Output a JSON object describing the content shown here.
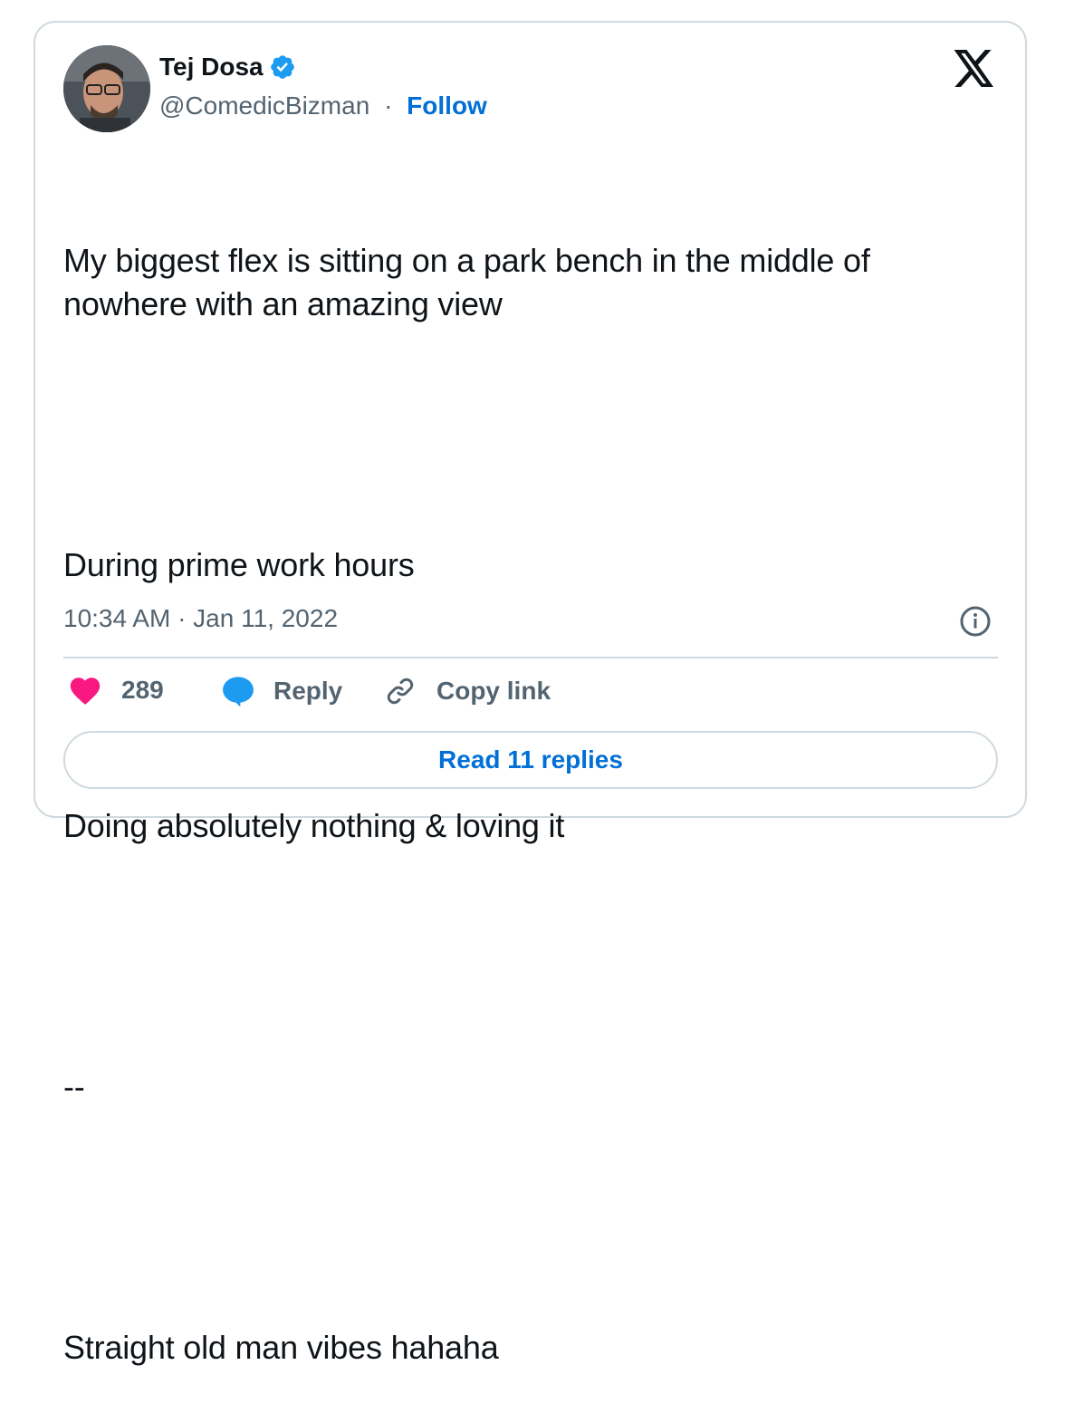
{
  "author": {
    "name": "Tej Dosa",
    "handle": "@ComedicBizman",
    "separator": "·",
    "follow_label": "Follow",
    "verified": true
  },
  "tweet": {
    "lines": [
      "My biggest flex is sitting on a park bench in the middle of nowhere with an amazing view",
      "",
      "During prime work hours",
      "",
      "Doing absolutely nothing & loving it",
      "",
      "--",
      "",
      "Straight old man vibes hahaha"
    ],
    "timestamp": "10:34 AM · Jan 11, 2022"
  },
  "actions": {
    "likes_count": "289",
    "reply_label": "Reply",
    "copy_link_label": "Copy link"
  },
  "read_replies_label": "Read 11 replies",
  "colors": {
    "like": "#f91880",
    "reply": "#1d9bf0",
    "link": "#006fd6",
    "verified": "#1d9bf0",
    "muted": "#536471",
    "border": "#cfd9de"
  },
  "icons": {
    "brand": "x-logo-icon",
    "verified": "verified-badge-icon",
    "info": "info-icon",
    "like": "heart-icon",
    "reply": "speech-bubble-icon",
    "copy": "link-icon"
  }
}
